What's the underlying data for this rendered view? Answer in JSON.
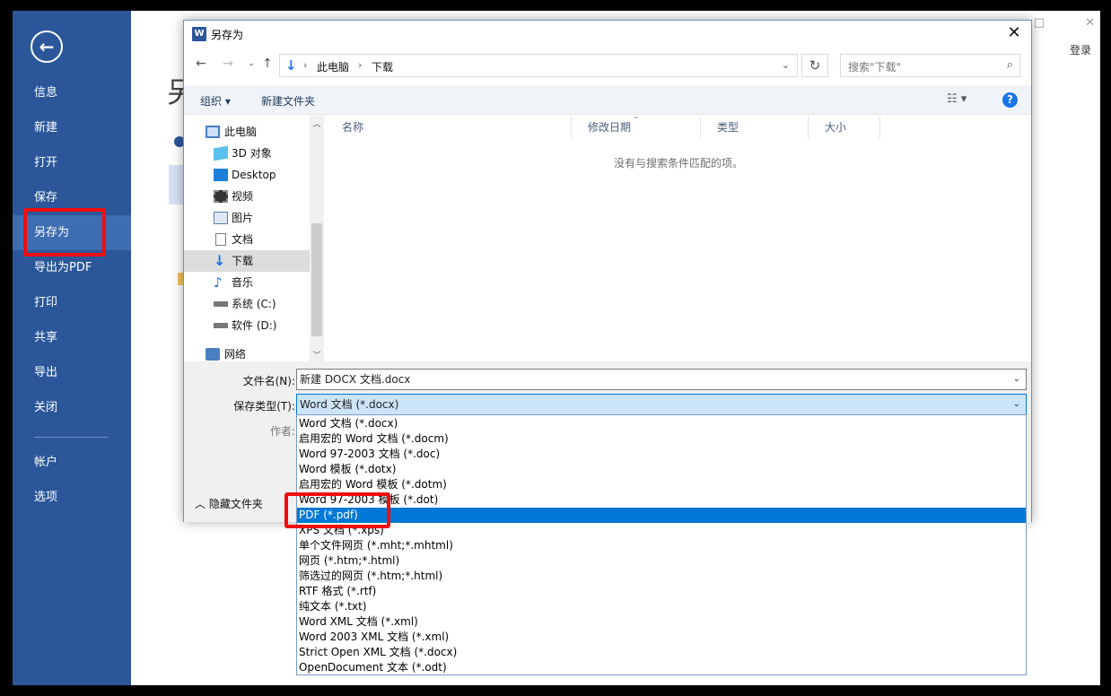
{
  "backstage": {
    "items": [
      {
        "label": "信息"
      },
      {
        "label": "新建"
      },
      {
        "label": "打开"
      },
      {
        "label": "保存"
      },
      {
        "label": "另存为",
        "active": true
      },
      {
        "label": "导出为PDF"
      },
      {
        "label": "打印"
      },
      {
        "label": "共享"
      },
      {
        "label": "导出"
      },
      {
        "label": "关闭"
      },
      {
        "label": "帐户"
      },
      {
        "label": "选项"
      }
    ],
    "login_label": "登录",
    "heading_fragment": "另"
  },
  "dialog": {
    "title": "另存为",
    "address": {
      "parts": [
        "此电脑",
        "下载"
      ],
      "separator": "›"
    },
    "search_placeholder": "搜索\"下载\"",
    "toolbar": {
      "organize_label": "组织 ▾",
      "new_folder_label": "新建文件夹"
    },
    "tree": [
      {
        "label": "此电脑",
        "icon": "computer-icon"
      },
      {
        "label": "3D 对象",
        "icon": "cube-icon"
      },
      {
        "label": "Desktop",
        "icon": "desktop-icon"
      },
      {
        "label": "视频",
        "icon": "video-icon"
      },
      {
        "label": "图片",
        "icon": "picture-icon"
      },
      {
        "label": "文档",
        "icon": "document-icon"
      },
      {
        "label": "下载",
        "icon": "download-icon",
        "selected": true
      },
      {
        "label": "音乐",
        "icon": "music-icon"
      },
      {
        "label": "系统 (C:)",
        "icon": "drive-icon"
      },
      {
        "label": "软件 (D:)",
        "icon": "drive-icon"
      },
      {
        "label": "网络",
        "icon": "network-icon"
      }
    ],
    "columns": [
      "名称",
      "修改日期",
      "类型",
      "大小"
    ],
    "empty_message": "没有与搜索条件匹配的项。",
    "filename_label": "文件名(N):",
    "filename_value": "新建 DOCX 文档.docx",
    "filetype_label": "保存类型(T):",
    "filetype_value": "Word 文档 (*.docx)",
    "author_label": "作者:",
    "hide_folders_label": "隐藏文件夹",
    "file_types": [
      "Word 文档 (*.docx)",
      "启用宏的 Word 文档 (*.docm)",
      "Word 97-2003 文档 (*.doc)",
      "Word 模板 (*.dotx)",
      "启用宏的 Word 模板 (*.dotm)",
      "Word 97-2003 模板 (*.dot)",
      "PDF (*.pdf)",
      "XPS 文档 (*.xps)",
      "单个文件网页 (*.mht;*.mhtml)",
      "网页 (*.htm;*.html)",
      "筛选过的网页 (*.htm;*.html)",
      "RTF 格式 (*.rtf)",
      "纯文本 (*.txt)",
      "Word XML 文档 (*.xml)",
      "Word 2003 XML 文档 (*.xml)",
      "Strict Open XML 文档 (*.docx)",
      "OpenDocument 文本 (*.odt)"
    ],
    "highlighted_type": "PDF (*.pdf)"
  },
  "colors": {
    "accent": "#2b579a",
    "highlight": "#0078d7",
    "annotation": "#f20d0d"
  }
}
